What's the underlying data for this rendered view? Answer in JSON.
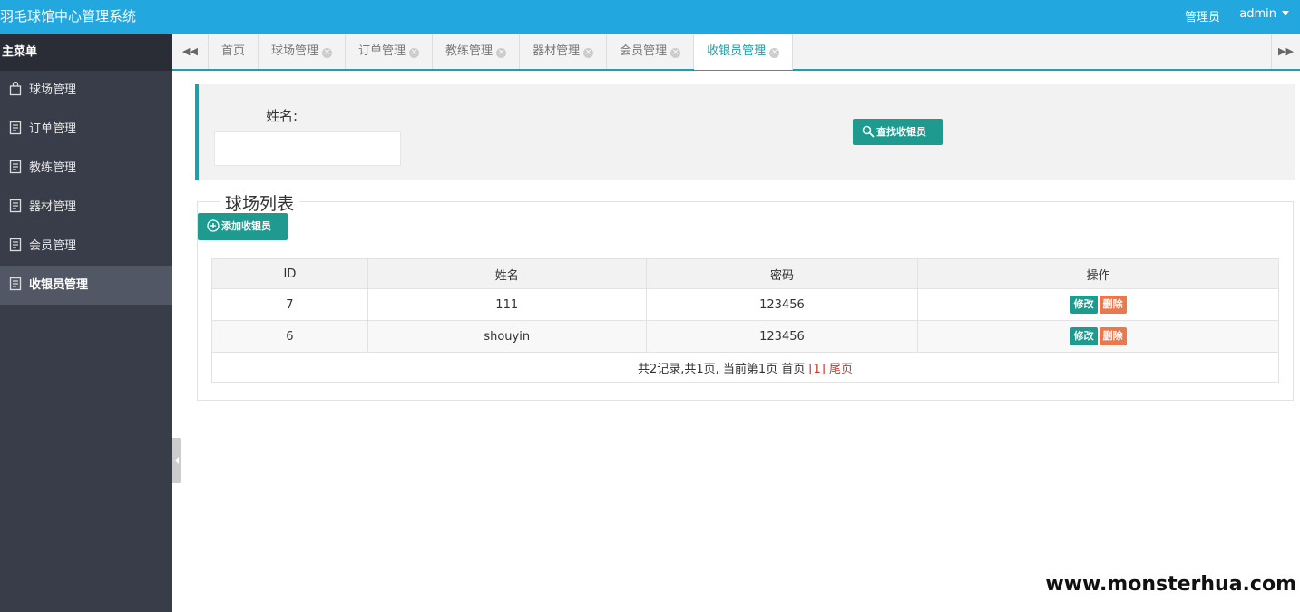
{
  "topbar": {
    "app_title": "羽毛球馆中心管理系统",
    "role": "管理员",
    "username": "admin"
  },
  "sidebar": {
    "header": "主菜单",
    "items": [
      {
        "label": "球场管理",
        "icon": "bag-icon",
        "active": false
      },
      {
        "label": "订单管理",
        "icon": "document-icon",
        "active": false
      },
      {
        "label": "教练管理",
        "icon": "document-icon",
        "active": false
      },
      {
        "label": "器材管理",
        "icon": "document-icon",
        "active": false
      },
      {
        "label": "会员管理",
        "icon": "document-icon",
        "active": false
      },
      {
        "label": "收银员管理",
        "icon": "document-icon",
        "active": true
      }
    ]
  },
  "tabs": [
    {
      "label": "首页",
      "closable": false,
      "active": false
    },
    {
      "label": "球场管理",
      "closable": true,
      "active": false
    },
    {
      "label": "订单管理",
      "closable": true,
      "active": false
    },
    {
      "label": "教练管理",
      "closable": true,
      "active": false
    },
    {
      "label": "器材管理",
      "closable": true,
      "active": false
    },
    {
      "label": "会员管理",
      "closable": true,
      "active": false
    },
    {
      "label": "收银员管理",
      "closable": true,
      "active": true
    }
  ],
  "search": {
    "name_label": "姓名:",
    "name_value": "",
    "button_label": "查找收银员"
  },
  "list": {
    "legend": "球场列表",
    "add_button_label": "添加收银员",
    "columns": [
      "ID",
      "姓名",
      "密码",
      "操作"
    ],
    "rows": [
      {
        "id": "7",
        "name": "111",
        "password": "123456"
      },
      {
        "id": "6",
        "name": "shouyin",
        "password": "123456"
      }
    ],
    "edit_label": "修改",
    "delete_label": "删除",
    "pagination": {
      "summary": "共2记录,共1页, 当前第1页",
      "first": "首页",
      "current": "[1]",
      "last": "尾页"
    }
  },
  "watermark": "www.monsterhua.com",
  "colors": {
    "topbar": "#23a7df",
    "sidebar": "#393d49",
    "accent": "#1e9fa9",
    "button_green": "#1e9a8e",
    "button_orange": "#e8794c"
  }
}
